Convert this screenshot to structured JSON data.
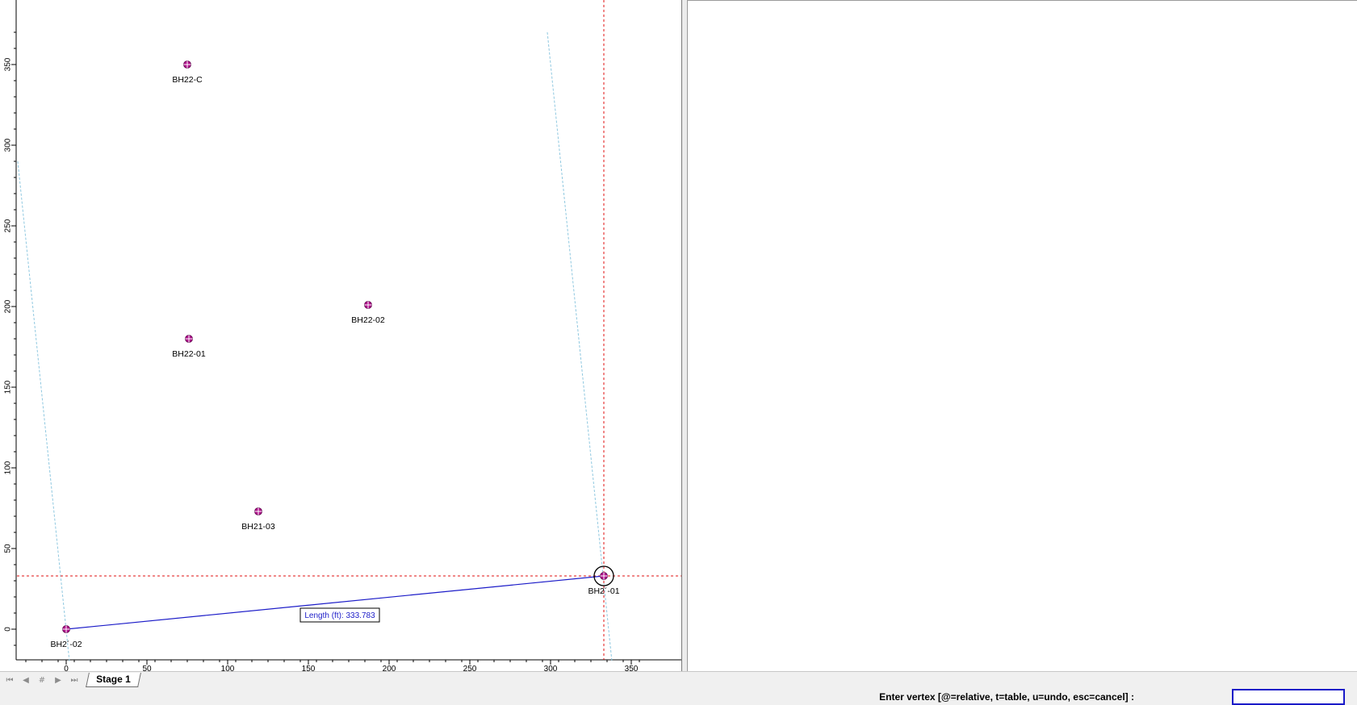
{
  "plot": {
    "chart_data": {
      "type": "scatter",
      "xlim": [
        -30,
        365
      ],
      "ylim": [
        -20,
        370
      ],
      "x_ticks": [
        0,
        50,
        100,
        150,
        200,
        250,
        300,
        350
      ],
      "y_ticks": [
        0,
        50,
        100,
        150,
        200,
        250,
        300,
        350
      ],
      "points": [
        {
          "name": "BH22-C",
          "x": 75,
          "y": 350
        },
        {
          "name": "BH22-02",
          "x": 187,
          "y": 201
        },
        {
          "name": "BH22-01",
          "x": 76,
          "y": 180
        },
        {
          "name": "BH21-03",
          "x": 119,
          "y": 73
        },
        {
          "name": "BH2´-01",
          "x": 333,
          "y": 33
        },
        {
          "name": "BH2´-02",
          "x": 0,
          "y": 0
        }
      ],
      "measure_line": {
        "from": [
          0,
          0
        ],
        "to": [
          333,
          33
        ]
      },
      "crosshair": {
        "x": 333,
        "y": 33
      },
      "guide_lines": [
        {
          "from": [
            -30,
            290
          ],
          "to": [
            2,
            -20
          ]
        },
        {
          "from": [
            298,
            370
          ],
          "to": [
            338,
            -20
          ]
        }
      ]
    },
    "length_label": "Length (ft): 333.783",
    "colors": {
      "measure_line": "#1c1cc8",
      "crosshair": "#e01010",
      "guide": "#8fc8e0",
      "marker": "#b0108c"
    }
  },
  "tabs": {
    "nav": [
      "first-icon",
      "prev-icon",
      "hash-icon",
      "next-icon",
      "last-icon"
    ],
    "stage_label": "Stage 1"
  },
  "status": {
    "prompt": "Enter vertex [@=relative, t=table, u=undo, esc=cancel] :",
    "input_value": ""
  }
}
